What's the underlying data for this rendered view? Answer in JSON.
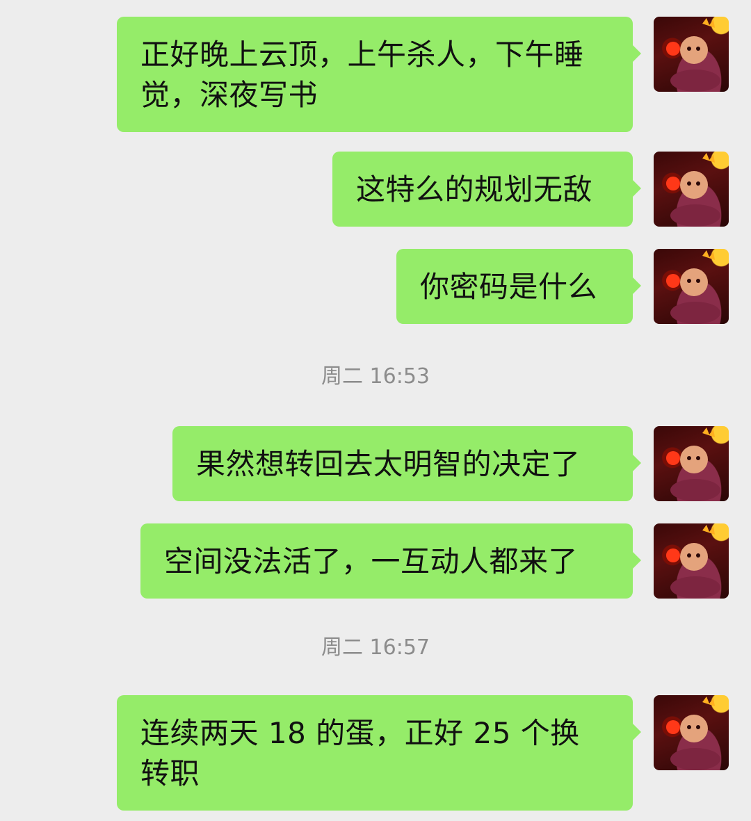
{
  "messages": [
    {
      "text": "正好晚上云顶，上午杀人，下午睡觉，深夜写书"
    },
    {
      "text": "这特么的规划无敌"
    },
    {
      "text": "你密码是什么"
    },
    {
      "text": "果然想转回去太明智的决定了"
    },
    {
      "text": "空间没法活了，一互动人都来了"
    },
    {
      "text": "连续两天 18 的蛋，正好 25 个换转职"
    }
  ],
  "timestamps": [
    {
      "text": "周二 16:53"
    },
    {
      "text": "周二 16:57"
    }
  ],
  "colors": {
    "bubble": "#95ec69",
    "background": "#ededed",
    "timestamp": "#8c8c8c"
  },
  "icons": {
    "avatar": "user-avatar-icon"
  }
}
